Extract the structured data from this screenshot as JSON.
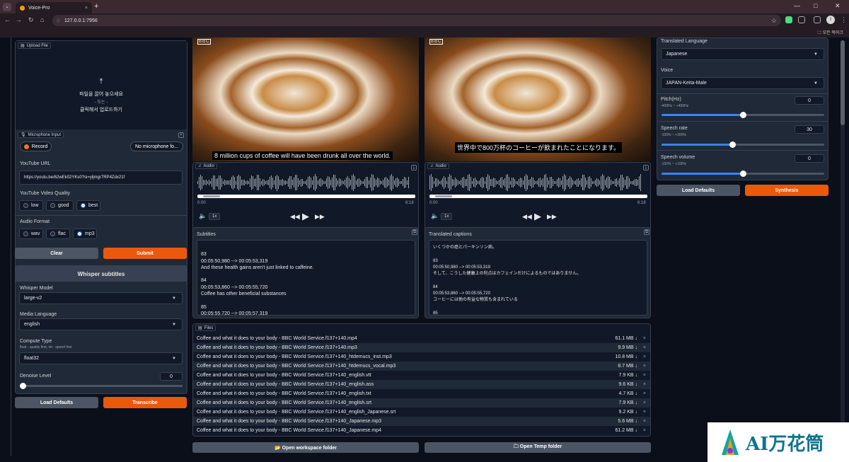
{
  "browser": {
    "tab_title": "Voice-Pro",
    "tab_close": "×",
    "new_tab": "+",
    "menu_glyph": "⌄",
    "url": "127.0.0.1:7956",
    "bookmark_folder": "모든 북마크",
    "avatar_letter": "I",
    "win_min": "—",
    "win_max": "□",
    "win_close": "✕",
    "back": "←",
    "forward": "→",
    "reload": "↻",
    "home": "⌂",
    "star": "☆"
  },
  "upload": {
    "label": "Upload File",
    "line1": "파일을 끌어 놓으세요",
    "line2": "- 또는 -",
    "line3": "클릭해서 업로드하기",
    "upload_glyph": "⤒"
  },
  "mic": {
    "label": "Microphone Input",
    "record": "Record",
    "device": "No microphone fo...",
    "close": "×"
  },
  "youtube": {
    "label": "YouTube URL",
    "value": "https://youtu.be/62wEk02YKs0?si=yljmgr7RP4Zdx21f"
  },
  "quality": {
    "label": "YouTube Video Quality",
    "options": [
      "low",
      "good",
      "best"
    ],
    "selected": 2
  },
  "audio_format": {
    "label": "Audio Format",
    "options": [
      "wav",
      "flac",
      "mp3"
    ],
    "selected": 2
  },
  "actions1": {
    "clear": "Clear",
    "submit": "Submit"
  },
  "whisper": {
    "title": "Whisper subtitles",
    "model_label": "Whisper Model",
    "model_value": "large-v2",
    "lang_label": "Media Language",
    "lang_value": "english",
    "compute_label": "Compute Type",
    "compute_sub": "float - quality first, int - speed first",
    "compute_value": "float32",
    "denoise_label": "Denoise Level",
    "denoise_value": "0",
    "denoise_level": 0
  },
  "actions2": {
    "load": "Load Defaults",
    "transcribe": "Transcribe"
  },
  "video_left": {
    "caption": "8 million cups of coffee will have been drunk all over the world.",
    "audio_tab": "Audio",
    "time_start": "0:00",
    "time_end": "6:18",
    "speed": "1x",
    "logo": "BBC"
  },
  "video_right": {
    "caption": "世界中で800万杯のコーヒーが飲まれたことになります。",
    "audio_tab": "Audio",
    "time_start": "0:00",
    "time_end": "6:18",
    "speed": "1x",
    "logo": "BBC"
  },
  "subtitles": {
    "label": "Subtitles",
    "text": "\n83\n00:05:50,980 --> 00:05:53,319\nAnd these health gains aren't just linked to caffeine.\n\n84\n00:05:53,860 --> 00:05:55,720\nCoffee has other beneficial substances\n\n85\n00:05:55,720 --> 00:05:57,319"
  },
  "translated": {
    "label": "Translated captions",
    "text": "いくつかの癌とパーキンソン病。\n\n83\n00:05:50,980 --> 00:05:53,319\nそして、こうした健康上の利点はカフェインだけによるものではありません。\n\n84\n00:05:53,860 --> 00:05:55,720\nコーヒーには他の有益な物質も含まれている\n\n85"
  },
  "files": {
    "label": "Files",
    "rows": [
      {
        "name": "Coffee and what it does to your body - BBC World Service.f137+140.mp4",
        "size": "61.1 MB ↓"
      },
      {
        "name": "Coffee and what it does to your body - BBC World Service.f137+140.mp3",
        "size": "9.9 MB ↓"
      },
      {
        "name": "Coffee and what it does to your body - BBC World Service.f137+140_htdemucs_inst.mp3",
        "size": "10.8 MB ↓"
      },
      {
        "name": "Coffee and what it does to your body - BBC World Service.f137+140_htdemucs_vocal.mp3",
        "size": "8.7 MB ↓"
      },
      {
        "name": "Coffee and what it does to your body - BBC World Service.f137+140_english.vtt",
        "size": "7.9 KB ↓"
      },
      {
        "name": "Coffee and what it does to your body - BBC World Service.f137+140_english.ass",
        "size": "9.6 KB ↓"
      },
      {
        "name": "Coffee and what it does to your body - BBC World Service.f137+140_english.txt",
        "size": "4.7 KB ↓"
      },
      {
        "name": "Coffee and what it does to your body - BBC World Service.f137+140_english.srt",
        "size": "7.9 KB ↓"
      },
      {
        "name": "Coffee and what it does to your body - BBC World Service.f137+140_english_Japanese.srt",
        "size": "9.2 KB ↓"
      },
      {
        "name": "Coffee and what it does to your body - BBC World Service.f137+140_Japanese.mp3",
        "size": "5.6 MB ↓"
      },
      {
        "name": "Coffee and what it does to your body - BBC World Service.f137+140_Japanese.mp4",
        "size": "61.2 MB ↓"
      }
    ],
    "delete_glyph": "×"
  },
  "folders": {
    "workspace": "📂 Open workspace folder",
    "temp": "🗀 Open Temp folder"
  },
  "tts": {
    "lang_label": "Translated Language",
    "lang_value": "Japanese",
    "voice_label": "Voice",
    "voice_value": "JAPAN-Keita-Male",
    "pitch_label": "Pitch(Hz)",
    "pitch_sub": "-400Hz ~ +400Hz",
    "pitch_value": "0",
    "pitch_level": 0.5,
    "rate_label": "Speech rate",
    "rate_sub": "-100% ~ +200%",
    "rate_value": "30",
    "rate_level": 0.4333,
    "volume_label": "Speech volume",
    "volume_sub": "-100% ~ +100%",
    "volume_value": "0",
    "volume_level": 0.5,
    "load": "Load Defaults",
    "synth": "Synthesis"
  },
  "watermark": "AI万花筒",
  "colors": {
    "accent": "#ea580c",
    "slider": "#3b82f6",
    "panel": "#1f2937",
    "bg": "#0b0f19"
  }
}
